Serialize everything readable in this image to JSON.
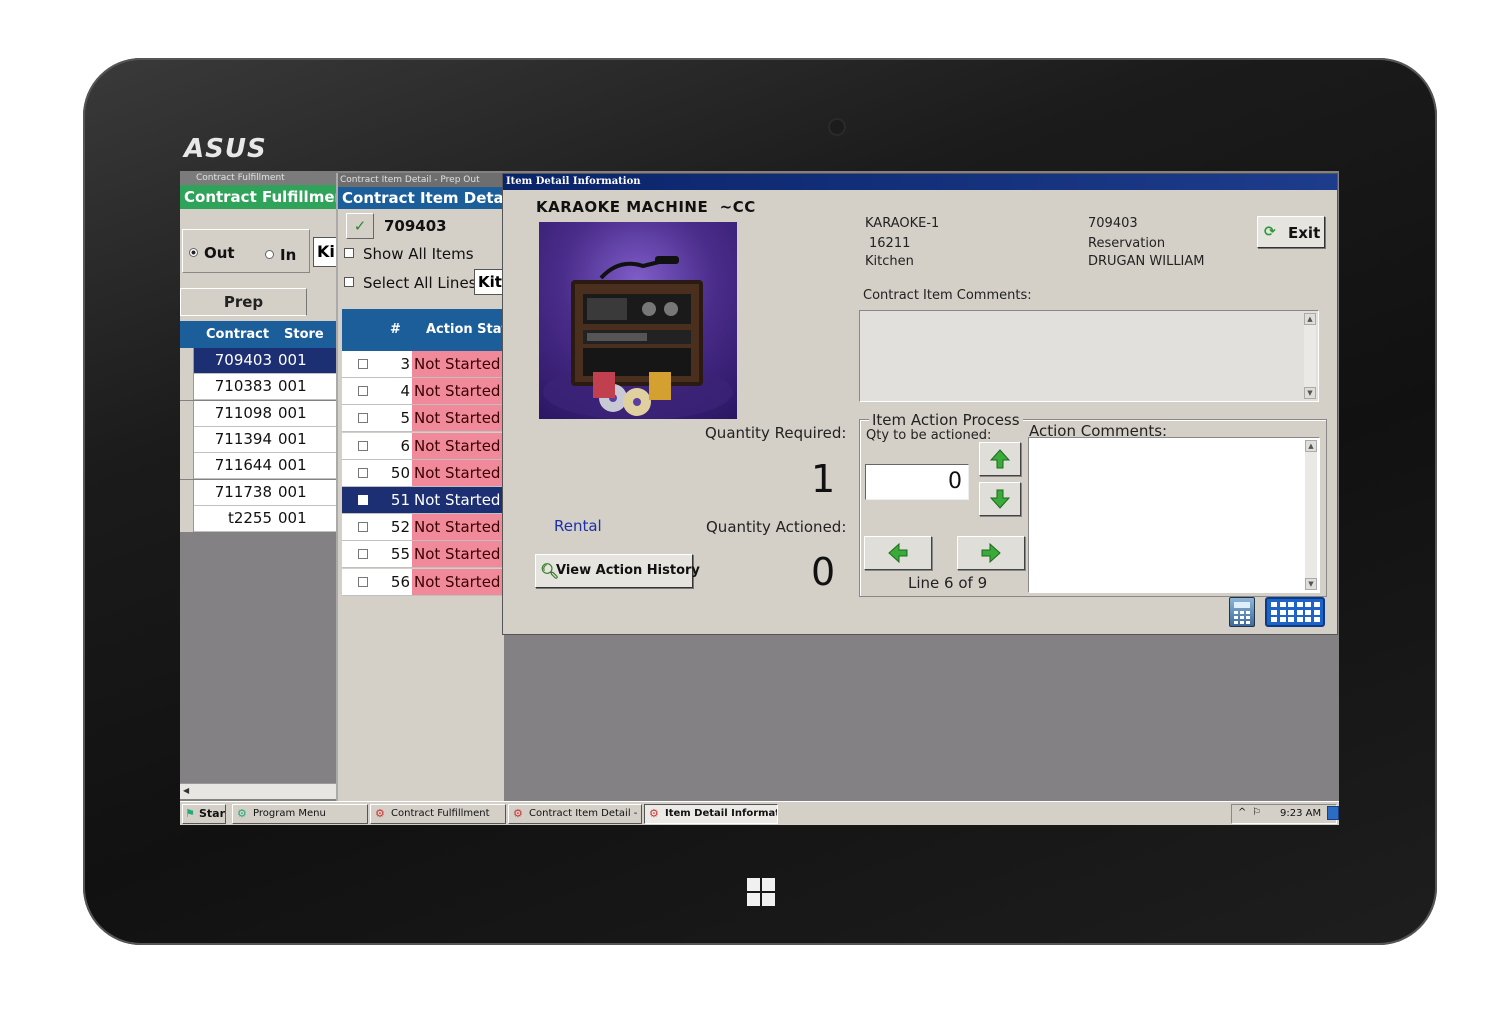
{
  "device": {
    "brand": "ASUS"
  },
  "window_fulfillment": {
    "title": "Contract Fulfillment",
    "banner": "Contract Fulfillment",
    "radio_out": "Out",
    "radio_in": "In",
    "location_value": "Ki",
    "tab_label": "Prep",
    "columns": [
      "Contract",
      "Store"
    ],
    "rows": [
      {
        "contract": "709403",
        "store": "001",
        "selected": true
      },
      {
        "contract": "710383",
        "store": "001"
      },
      {
        "contract": "711098",
        "store": "001"
      },
      {
        "contract": "711394",
        "store": "001"
      },
      {
        "contract": "711644",
        "store": "001"
      },
      {
        "contract": "711738",
        "store": "001"
      },
      {
        "contract": "t2255",
        "store": "001"
      }
    ]
  },
  "window_item_detail": {
    "title": "Contract Item Detail - Prep Out",
    "banner": "Contract Item Detail",
    "contract_number": "709403",
    "show_all_items": "Show All Items",
    "select_all_lines": "Select All Lines",
    "location_value": "Kitc",
    "columns": [
      "#",
      "Action Status"
    ],
    "rows": [
      {
        "num": "3",
        "status": "Not Started"
      },
      {
        "num": "4",
        "status": "Not Started"
      },
      {
        "num": "5",
        "status": "Not Started"
      },
      {
        "num": "6",
        "status": "Not Started"
      },
      {
        "num": "50",
        "status": "Not Started"
      },
      {
        "num": "51",
        "status": "Not Started",
        "selected": true
      },
      {
        "num": "52",
        "status": "Not Started"
      },
      {
        "num": "55",
        "status": "Not Started"
      },
      {
        "num": "56",
        "status": "Not Started"
      }
    ]
  },
  "window_item_info": {
    "title": "Item Detail Information",
    "item_name": "KARAOKE MACHINE  ~CC",
    "item_code": "KARAOKE-1",
    "item_number": "16211",
    "category": "Kitchen",
    "contract": "709403",
    "contract_type": "Reservation",
    "customer": "DRUGAN WILLIAM",
    "exit_label": "Exit",
    "contract_item_comments_label": "Contract Item Comments:",
    "quantity_required_label": "Quantity Required:",
    "quantity_required": "1",
    "quantity_actioned_label": "Quantity Actioned:",
    "quantity_actioned": "0",
    "rental_label": "Rental",
    "view_history_label": "View Action History",
    "item_action_process_label": "Item Action Process",
    "qty_to_be_actioned_label": "Qty to be actioned:",
    "qty_value": "0",
    "line_position": "Line 6 of 9",
    "action_comments_label": "Action Comments:"
  },
  "taskbar": {
    "start": "Start",
    "items": [
      {
        "label": "Program Menu"
      },
      {
        "label": "Contract Fulfillment"
      },
      {
        "label": "Contract Item Detail - Pr..."
      },
      {
        "label": "Item Detail Informati...",
        "active": true
      }
    ],
    "clock": "9:23 AM"
  },
  "colors": {
    "fulfillment_banner": "#2fa35a",
    "grid_header": "#1c5e9a",
    "selected_row": "#1c2f73",
    "not_started": "#f08a9a",
    "title_bar": "#0a246a"
  }
}
